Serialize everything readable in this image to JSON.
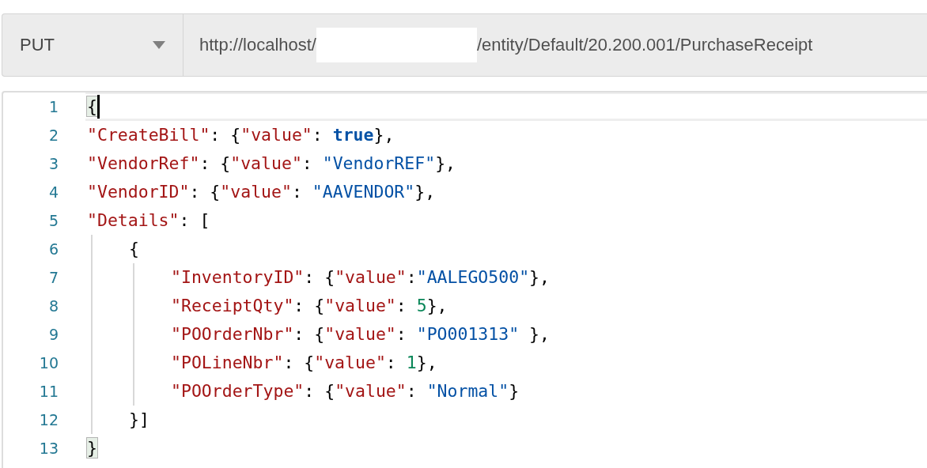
{
  "request": {
    "method": "PUT",
    "url_start": "http://localhost/",
    "url_end": "/entity/Default/20.200.001/PurchaseReceipt",
    "redacted": true
  },
  "editor": {
    "lines": [
      {
        "number": "1",
        "cursor": true,
        "bracket_highlight": true,
        "tokens": [
          {
            "kind": "punct",
            "text": "{"
          }
        ]
      },
      {
        "number": "2",
        "tokens": [
          {
            "kind": "key",
            "text": "\"CreateBill\""
          },
          {
            "kind": "punct",
            "text": ": {"
          },
          {
            "kind": "key",
            "text": "\"value\""
          },
          {
            "kind": "punct",
            "text": ": "
          },
          {
            "kind": "bool",
            "text": "true"
          },
          {
            "kind": "punct",
            "text": "},"
          }
        ]
      },
      {
        "number": "3",
        "tokens": [
          {
            "kind": "key",
            "text": "\"VendorRef\""
          },
          {
            "kind": "punct",
            "text": ": {"
          },
          {
            "kind": "key",
            "text": "\"value\""
          },
          {
            "kind": "punct",
            "text": ": "
          },
          {
            "kind": "string",
            "text": "\"VendorREF\""
          },
          {
            "kind": "punct",
            "text": "},"
          }
        ]
      },
      {
        "number": "4",
        "tokens": [
          {
            "kind": "key",
            "text": "\"VendorID\""
          },
          {
            "kind": "punct",
            "text": ": {"
          },
          {
            "kind": "key",
            "text": "\"value\""
          },
          {
            "kind": "punct",
            "text": ": "
          },
          {
            "kind": "string",
            "text": "\"AAVENDOR\""
          },
          {
            "kind": "punct",
            "text": "},"
          }
        ]
      },
      {
        "number": "5",
        "tokens": [
          {
            "kind": "key",
            "text": "\"Details\""
          },
          {
            "kind": "punct",
            "text": ": ["
          }
        ],
        "children": [
          {
            "number": "6",
            "tokens": [
              {
                "kind": "punct",
                "text": "{"
              }
            ],
            "children": [
              {
                "number": "7",
                "tokens": [
                  {
                    "kind": "key",
                    "text": "\"InventoryID\""
                  },
                  {
                    "kind": "punct",
                    "text": ": {"
                  },
                  {
                    "kind": "key",
                    "text": "\"value\""
                  },
                  {
                    "kind": "punct",
                    "text": ":"
                  },
                  {
                    "kind": "string",
                    "text": "\"AALEGO500\""
                  },
                  {
                    "kind": "punct",
                    "text": "},"
                  }
                ]
              },
              {
                "number": "8",
                "tokens": [
                  {
                    "kind": "key",
                    "text": "\"ReceiptQty\""
                  },
                  {
                    "kind": "punct",
                    "text": ": {"
                  },
                  {
                    "kind": "key",
                    "text": "\"value\""
                  },
                  {
                    "kind": "punct",
                    "text": ": "
                  },
                  {
                    "kind": "number",
                    "text": "5"
                  },
                  {
                    "kind": "punct",
                    "text": "},"
                  }
                ]
              },
              {
                "number": "9",
                "tokens": [
                  {
                    "kind": "key",
                    "text": "\"POOrderNbr\""
                  },
                  {
                    "kind": "punct",
                    "text": ": {"
                  },
                  {
                    "kind": "key",
                    "text": "\"value\""
                  },
                  {
                    "kind": "punct",
                    "text": ": "
                  },
                  {
                    "kind": "string",
                    "text": "\"PO001313\""
                  },
                  {
                    "kind": "punct",
                    "text": " },"
                  }
                ]
              },
              {
                "number": "10",
                "tokens": [
                  {
                    "kind": "key",
                    "text": "\"POLineNbr\""
                  },
                  {
                    "kind": "punct",
                    "text": ": {"
                  },
                  {
                    "kind": "key",
                    "text": "\"value\""
                  },
                  {
                    "kind": "punct",
                    "text": ": "
                  },
                  {
                    "kind": "number",
                    "text": "1"
                  },
                  {
                    "kind": "punct",
                    "text": "},"
                  }
                ]
              },
              {
                "number": "11",
                "tokens": [
                  {
                    "kind": "key",
                    "text": "\"POOrderType\""
                  },
                  {
                    "kind": "punct",
                    "text": ": {"
                  },
                  {
                    "kind": "key",
                    "text": "\"value\""
                  },
                  {
                    "kind": "punct",
                    "text": ": "
                  },
                  {
                    "kind": "string",
                    "text": "\"Normal\""
                  },
                  {
                    "kind": "punct",
                    "text": "}"
                  }
                ]
              }
            ]
          },
          {
            "number": "12",
            "tokens": [
              {
                "kind": "punct",
                "text": "}]"
              }
            ]
          }
        ]
      },
      {
        "number": "13",
        "bracket_highlight": true,
        "tokens": [
          {
            "kind": "punct",
            "text": "}"
          }
        ]
      }
    ]
  }
}
